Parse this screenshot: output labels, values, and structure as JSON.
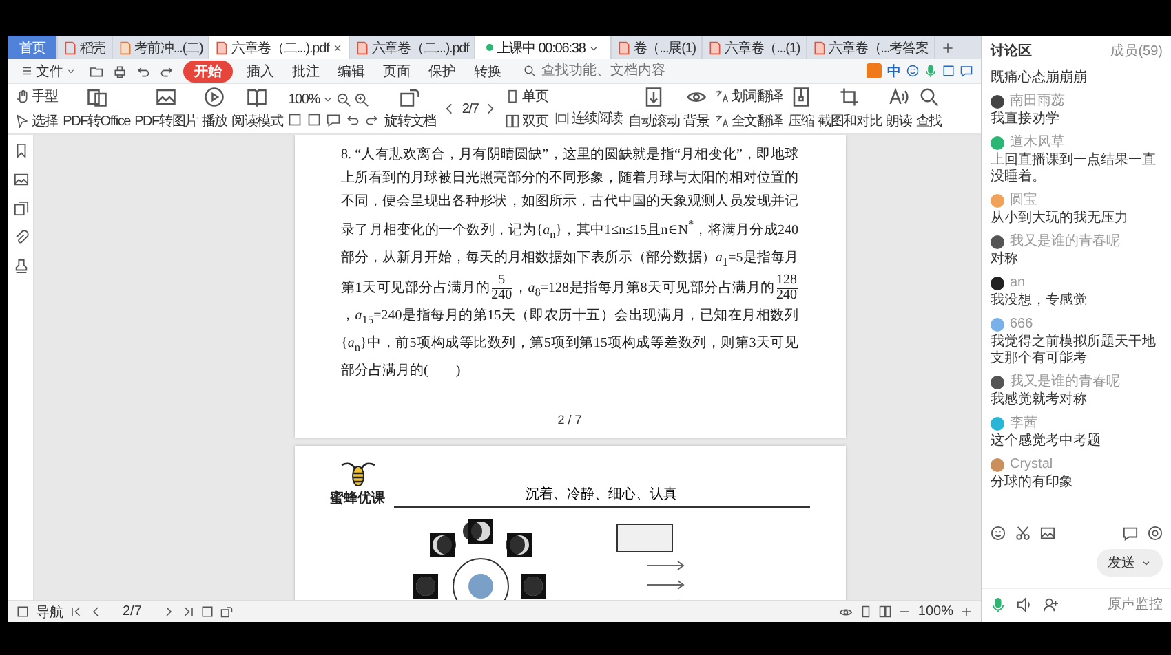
{
  "tabs": [
    {
      "label": "首页",
      "kind": "home",
      "selected": false
    },
    {
      "label": "稻壳",
      "kind": "docer",
      "selected": false
    },
    {
      "label": "考前冲...(二)",
      "kind": "doc",
      "selected": false
    },
    {
      "label": "六章卷（二...).pdf",
      "kind": "pdf",
      "selected": true
    },
    {
      "label": "六章卷（二...).pdf",
      "kind": "pdf",
      "selected": false
    },
    {
      "label": "上课中 00:06:38",
      "kind": "live",
      "selected": false
    },
    {
      "label": "卷（...展(1)",
      "kind": "pdf",
      "selected": false
    },
    {
      "label": "六章卷（...(1)",
      "kind": "pdf",
      "selected": false
    },
    {
      "label": "六章卷（...考答案",
      "kind": "pdf",
      "selected": false
    }
  ],
  "menu": {
    "items": [
      {
        "label": "文件",
        "kind": "file",
        "selected": false
      },
      {
        "label": "开始",
        "kind": "tab",
        "selected": true
      },
      {
        "label": "插入",
        "kind": "tab",
        "selected": false
      },
      {
        "label": "批注",
        "kind": "tab",
        "selected": false
      },
      {
        "label": "编辑",
        "kind": "tab",
        "selected": false
      },
      {
        "label": "页面",
        "kind": "tab",
        "selected": false
      },
      {
        "label": "保护",
        "kind": "tab",
        "selected": false
      },
      {
        "label": "转换",
        "kind": "tab",
        "selected": false
      }
    ],
    "search": {
      "placeholder": "查找功能、文档内容"
    },
    "ime": {
      "label": "中"
    }
  },
  "toolbar": {
    "items": [
      {
        "kind": "stack",
        "labels": [
          "手型",
          "选择"
        ]
      },
      {
        "kind": "tool",
        "label": "PDF转Office"
      },
      {
        "kind": "tool",
        "label": "PDF转图片"
      },
      {
        "kind": "tool",
        "label": "播放"
      },
      {
        "kind": "tool",
        "label": "阅读模式"
      },
      {
        "kind": "zoom",
        "value": "100%"
      },
      {
        "kind": "tool",
        "label": "旋转文档"
      },
      {
        "kind": "pager",
        "value": "2/7"
      },
      {
        "kind": "stack",
        "labels": [
          "单页",
          "双页"
        ]
      },
      {
        "kind": "mode",
        "label": "连续阅读"
      },
      {
        "kind": "tool",
        "label": "自动滚动"
      },
      {
        "kind": "tool",
        "label": "背景"
      },
      {
        "kind": "stack",
        "labels": [
          "划词翻译",
          "全文翻译"
        ]
      },
      {
        "kind": "tool",
        "label": "压缩"
      },
      {
        "kind": "tool",
        "label": "截图和对比"
      },
      {
        "kind": "tool",
        "label": "朗读"
      },
      {
        "kind": "tool",
        "label": "查找"
      }
    ]
  },
  "document": {
    "page_1": {
      "question": [
        {
          "kind": "text",
          "text": "8. “人有悲欢离合，月有阴晴圆缺”，这里的圆缺就是指“月相变化”，即地球上所看到的月球被日光照亮部分的不同形象，随着月球与太阳的相对位置的不同，便会呈现出各种形状，如图所示，古代中国的天象观测人员发现并记录了月相变化的一个数列，记为{*a*$_{n}$}，其中1≤n≤15且n∈N$^{*}$，将满月分成240部分，从新月开始，每天的月相数据如下表所示（部分数据）*a*$_{1}$=5是指每月第1天可见部分占满月的"
        },
        {
          "kind": "fraction",
          "numerator": "5",
          "denominator": "240"
        },
        {
          "kind": "text",
          "text": "，*a*$_{8}$=128是指每月第8天可见部分占满月的"
        },
        {
          "kind": "fraction",
          "numerator": "128",
          "denominator": "240"
        },
        {
          "kind": "text",
          "text": "，*a*$_{15}$=240是指每月的第15天（即农历十五）会出现满月，已知在月相数列{*a*$_{n}$}中，前5项构成等比数列，第5项到第15项构成等差数列，则第3天可见部分占满月的(　　)"
        }
      ],
      "page_number": "2 / 7"
    },
    "page_2": {
      "logo": "蜜蜂优课",
      "motto": "沉着、冷静、细心、认真"
    }
  },
  "chat": {
    "title": "讨论区",
    "members": "成员(59)",
    "messages": [
      {
        "text": "既痛心态崩崩崩"
      },
      {
        "name": "南田雨蕊",
        "color": "#444444",
        "text": "我直接劝学"
      },
      {
        "name": "道木风草",
        "color": "#2bb673",
        "text": "上回直播课到一点结果一直没睡着。"
      },
      {
        "name": "圆宝",
        "color": "#f0a15a",
        "text": "从小到大玩的我无压力"
      },
      {
        "name": "我又是谁的青春呢",
        "color": "#555555",
        "text": "对称"
      },
      {
        "name": "an",
        "color": "#222222",
        "text": "我没想，专感觉"
      },
      {
        "name": "666",
        "color": "#7ab0e8",
        "text": "我觉得之前模拟所题天干地支那个有可能考"
      },
      {
        "name": "我又是谁的青春呢",
        "color": "#555555",
        "text": "我感觉就考对称"
      },
      {
        "name": "李茜",
        "color": "#29b6d6",
        "text": "这个感觉考中考题"
      },
      {
        "name": "Crystal",
        "color": "#c9905e",
        "text": "分球的有印象"
      }
    ],
    "send": "发送",
    "monitor": "原声监控"
  },
  "status_bar": {
    "nav": "导航",
    "page": "2/7",
    "zoom": "100%"
  }
}
